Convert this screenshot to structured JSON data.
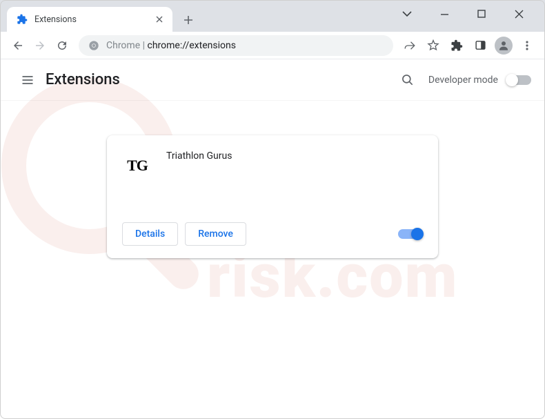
{
  "window": {
    "tab_title": "Extensions"
  },
  "addressbar": {
    "host_label": "Chrome",
    "url": "chrome://extensions"
  },
  "header": {
    "title": "Extensions",
    "developer_mode_label": "Developer mode",
    "developer_mode_enabled": false
  },
  "extension": {
    "icon_text": "TG",
    "name": "Triathlon Gurus",
    "details_label": "Details",
    "remove_label": "Remove",
    "enabled": true
  }
}
